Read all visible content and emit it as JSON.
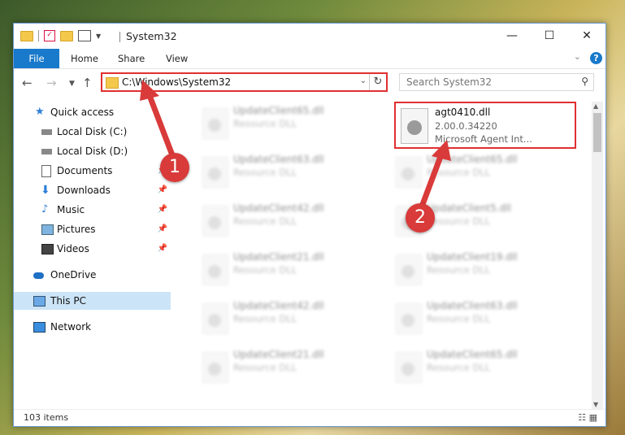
{
  "window": {
    "title": "System32",
    "controls": {
      "minimize": "—",
      "maximize": "☐",
      "close": "✕"
    }
  },
  "ribbon": {
    "tabs": [
      "File",
      "Home",
      "Share",
      "View"
    ],
    "collapse_icon": "chevron-down-icon",
    "help_label": "?"
  },
  "navigation": {
    "back_icon": "back-arrow-icon",
    "forward_icon": "forward-arrow-icon",
    "recent_icon": "chevron-down-icon",
    "up_icon": "up-arrow-icon",
    "address": "C:\\Windows\\System32",
    "refresh_icon": "refresh-icon"
  },
  "search": {
    "placeholder": "Search System32"
  },
  "nav_pane": {
    "items": [
      {
        "label": "Quick access",
        "icon": "star-icon",
        "pinned": false
      },
      {
        "label": "Local Disk (C:)",
        "icon": "drive-icon",
        "pinned": false
      },
      {
        "label": "Local Disk (D:)",
        "icon": "drive-icon",
        "pinned": false
      },
      {
        "label": "Documents",
        "icon": "document-icon",
        "pinned": true
      },
      {
        "label": "Downloads",
        "icon": "download-icon",
        "pinned": true
      },
      {
        "label": "Music",
        "icon": "music-icon",
        "pinned": true
      },
      {
        "label": "Pictures",
        "icon": "pictures-icon",
        "pinned": true
      },
      {
        "label": "Videos",
        "icon": "video-icon",
        "pinned": true
      },
      {
        "label": "OneDrive",
        "icon": "cloud-icon",
        "pinned": false
      },
      {
        "label": "This PC",
        "icon": "computer-icon",
        "pinned": false,
        "selected": true
      },
      {
        "label": "Network",
        "icon": "network-icon",
        "pinned": false
      }
    ]
  },
  "files": {
    "left_column": [
      {
        "name": "UpdateClient65.dll",
        "desc": "Resource DLL"
      },
      {
        "name": "UpdateClient63.dll",
        "desc": "Resource DLL"
      },
      {
        "name": "UpdateClient42.dll",
        "desc": "Resource DLL"
      },
      {
        "name": "UpdateClient21.dll",
        "desc": "Resource DLL"
      },
      {
        "name": "UpdateClient42.dll",
        "desc": "Resource DLL"
      },
      {
        "name": "UpdateClient21.dll",
        "desc": "Resource DLL"
      }
    ],
    "right_column": [
      {
        "name": "UpdateClient65.dll",
        "desc": "Resource DLL"
      },
      {
        "name": "UpdateClient5.dll",
        "desc": "Resource DLL"
      },
      {
        "name": "UpdateClient19.dll",
        "desc": "Resource DLL"
      },
      {
        "name": "UpdateClient63.dll",
        "desc": "Resource DLL"
      },
      {
        "name": "UpdateClient65.dll",
        "desc": "Resource DLL"
      }
    ],
    "highlighted": {
      "name": "agt0410.dll",
      "version": "2.00.0.34220",
      "company": "Microsoft Agent Int..."
    }
  },
  "status": {
    "item_count": "103 items"
  },
  "annotations": {
    "badge_1": "1",
    "badge_2": "2",
    "color": "#d93a3a"
  }
}
